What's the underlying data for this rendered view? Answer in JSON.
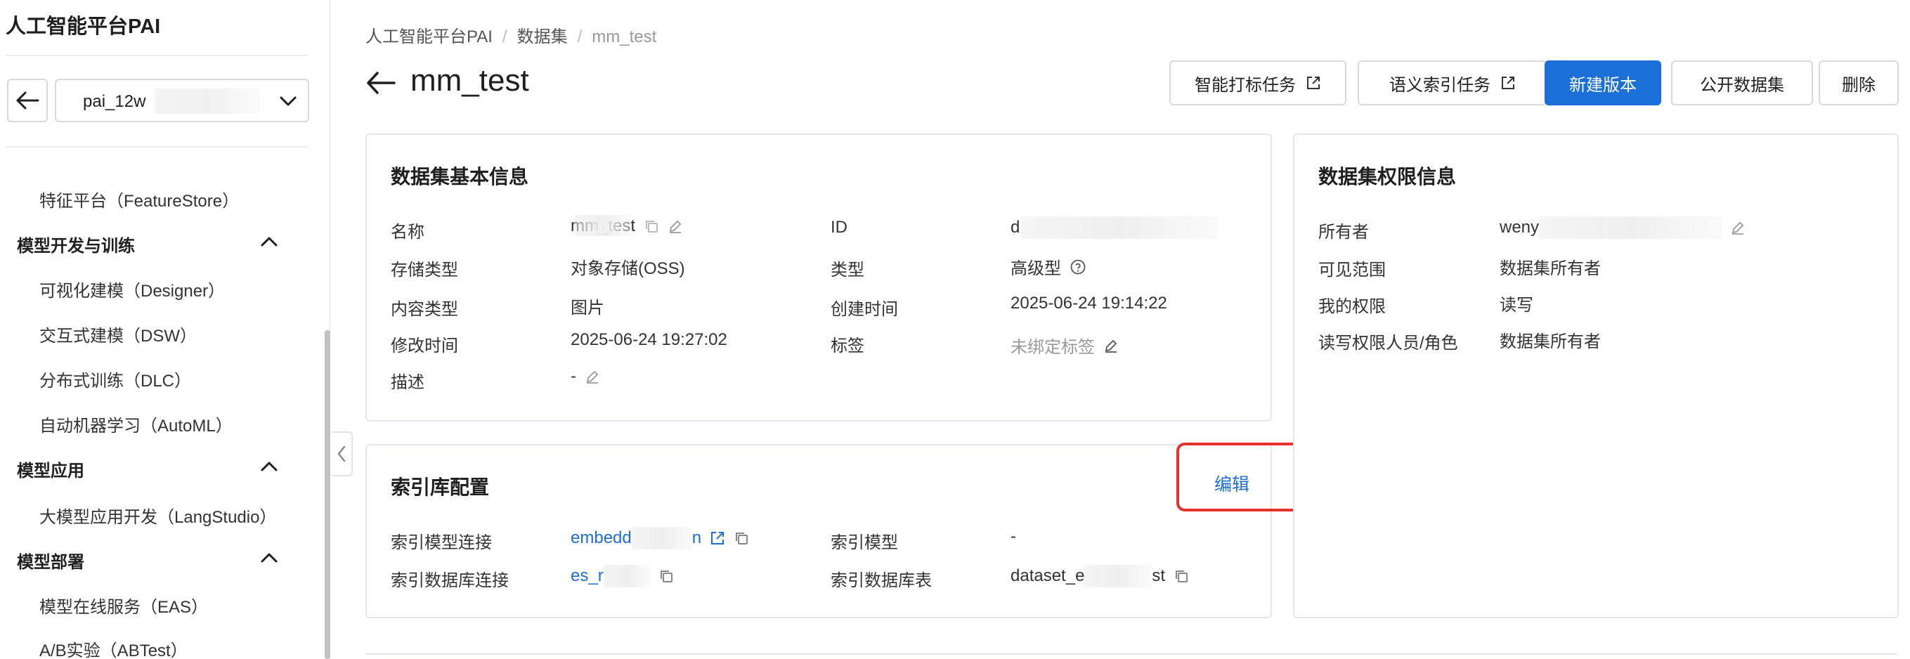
{
  "sidebar": {
    "title": "人工智能平台PAI",
    "workspace": "pai_12w",
    "items": {
      "feature_store": "特征平台（FeatureStore）",
      "group_dev": "模型开发与训练",
      "designer": "可视化建模（Designer）",
      "dsw": "交互式建模（DSW）",
      "dlc": "分布式训练（DLC）",
      "automl": "自动机器学习（AutoML）",
      "group_app": "模型应用",
      "langstudio": "大模型应用开发（LangStudio）",
      "group_deploy": "模型部署",
      "eas": "模型在线服务（EAS）",
      "abtest": "A/B实验（ABTest）"
    }
  },
  "breadcrumb": {
    "root": "人工智能平台PAI",
    "datasets": "数据集",
    "current": "mm_test"
  },
  "page_title": "mm_test",
  "actions": {
    "smart_label": "智能打标任务",
    "semantic_index": "语义索引任务",
    "new_version": "新建版本",
    "publish": "公开数据集",
    "delete": "删除"
  },
  "basic_info": {
    "title": "数据集基本信息",
    "name_label": "名称",
    "name_value": "mm_test",
    "id_label": "ID",
    "id_value": "d",
    "storage_label": "存储类型",
    "storage_value": "对象存储(OSS)",
    "type_label": "类型",
    "type_value": "高级型",
    "content_label": "内容类型",
    "content_value": "图片",
    "created_label": "创建时间",
    "created_value": "2025-06-24 19:14:22",
    "modified_label": "修改时间",
    "modified_value": "2025-06-24 19:27:02",
    "tags_label": "标签",
    "tags_value": "未绑定标签",
    "desc_label": "描述",
    "desc_value": "-"
  },
  "index_config": {
    "title": "索引库配置",
    "edit": "编辑",
    "model_conn_label": "索引模型连接",
    "model_conn_value": "embedd",
    "model_conn_suffix": "n",
    "model_label": "索引模型",
    "model_value": "-",
    "db_conn_label": "索引数据库连接",
    "db_conn_value": "es_r",
    "db_table_label": "索引数据库表",
    "db_table_prefix": "dataset_e",
    "db_table_suffix": "st"
  },
  "permission": {
    "title": "数据集权限信息",
    "owner_label": "所有者",
    "owner_value": "weny",
    "scope_label": "可见范围",
    "scope_value": "数据集所有者",
    "mine_label": "我的权限",
    "mine_value": "读写",
    "rw_label": "读写权限人员/角色",
    "rw_value": "数据集所有者"
  },
  "colors": {
    "primary": "#1b6fd6",
    "highlight": "#e5322d"
  }
}
